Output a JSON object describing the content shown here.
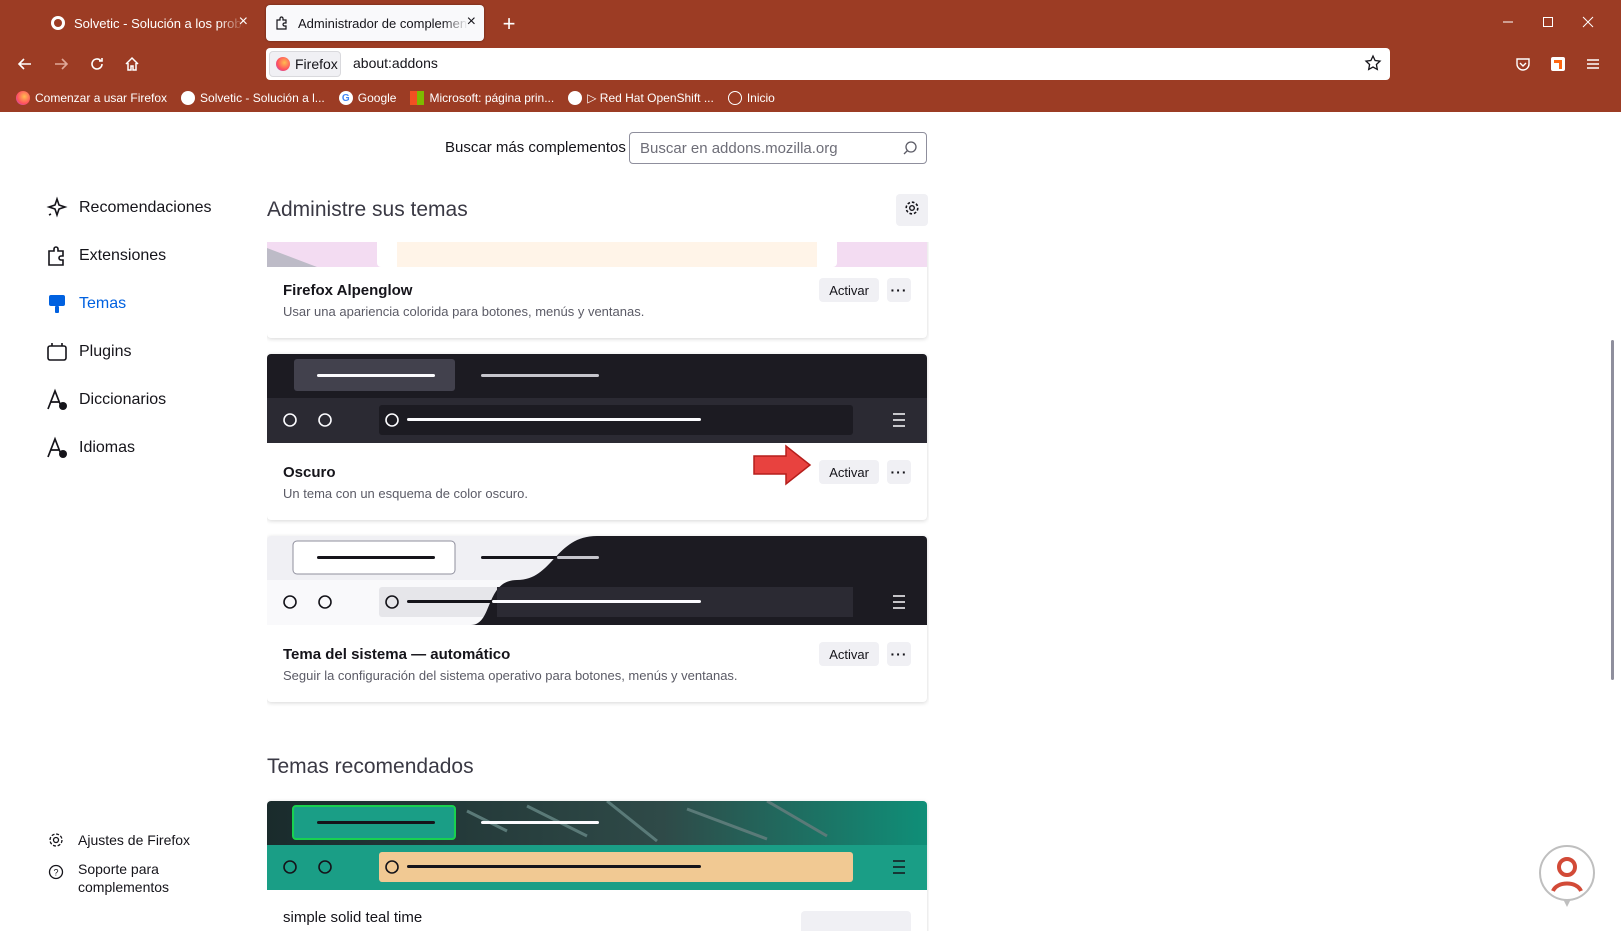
{
  "tabs": [
    {
      "title": "Solvetic - Solución a los problemas informáticos",
      "active": false
    },
    {
      "title": "Administrador de complementos",
      "active": true
    }
  ],
  "urlbar": {
    "identity_label": "Firefox",
    "url": "about:addons"
  },
  "bookmarks": [
    {
      "label": "Comenzar a usar Firefox",
      "icon": "firefox-icon"
    },
    {
      "label": "Solvetic - Solución a l...",
      "icon": "solvetic-icon"
    },
    {
      "label": "Google",
      "icon": "google-icon"
    },
    {
      "label": "Microsoft: página prin...",
      "icon": "microsoft-icon"
    },
    {
      "label": "▷ Red Hat OpenShift ...",
      "icon": "solvetic-icon"
    },
    {
      "label": "Inicio",
      "icon": "globe-icon"
    }
  ],
  "search": {
    "label": "Buscar más complementos",
    "placeholder": "Buscar en addons.mozilla.org"
  },
  "sidebar": {
    "categories": [
      {
        "label": "Recomendaciones",
        "icon": "sparkle-icon",
        "selected": false
      },
      {
        "label": "Extensiones",
        "icon": "puzzle-icon",
        "selected": false
      },
      {
        "label": "Temas",
        "icon": "brush-icon",
        "selected": true
      },
      {
        "label": "Plugins",
        "icon": "plugin-icon",
        "selected": false
      },
      {
        "label": "Diccionarios",
        "icon": "dictionary-icon",
        "selected": false
      },
      {
        "label": "Idiomas",
        "icon": "language-icon",
        "selected": false
      }
    ],
    "footer": [
      {
        "label": "Ajustes de Firefox",
        "icon": "gear-icon"
      },
      {
        "label": "Soporte para complementos",
        "icon": "help-icon"
      }
    ]
  },
  "main": {
    "heading": "Administre sus temas",
    "themes": [
      {
        "name": "Firefox Alpenglow",
        "description": "Usar una apariencia colorida para botones, menús y ventanas.",
        "action": "Activar"
      },
      {
        "name": "Oscuro",
        "description": "Un tema con un esquema de color oscuro.",
        "action": "Activar"
      },
      {
        "name": "Tema del sistema — automático",
        "description": "Seguir la configuración del sistema operativo para botones, menús y ventanas.",
        "action": "Activar"
      }
    ],
    "recommended_heading": "Temas recomendados",
    "recommended": [
      {
        "name": "simple solid teal time"
      }
    ]
  },
  "colors": {
    "chrome": "#9c3c24",
    "accent": "#0061e0",
    "arrow": "#e8423f",
    "teal": "#1a9e86"
  }
}
